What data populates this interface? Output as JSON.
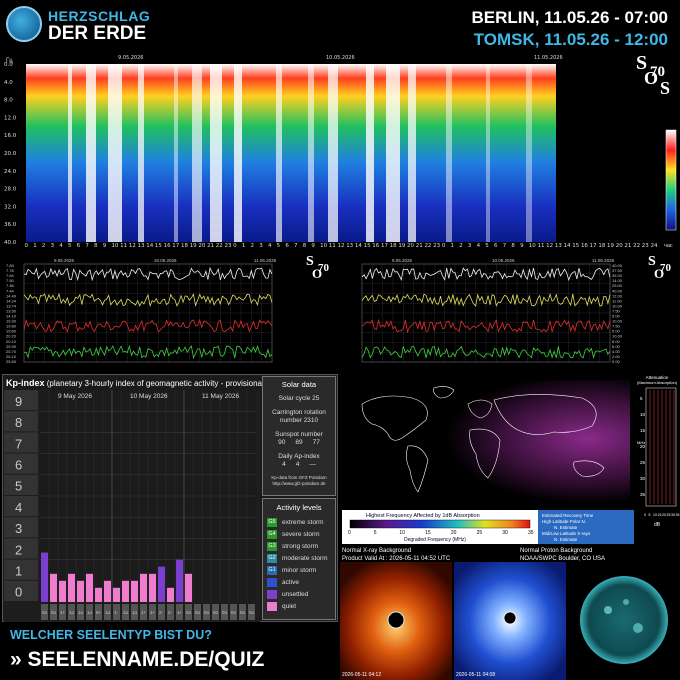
{
  "header": {
    "logo_line1": "HERZSCHLAG",
    "logo_line2": "DER ERDE",
    "city1": "BERLIN, 11.05.26 - 07:00",
    "city2": "TOMSK, 11.05.26 - 12:00"
  },
  "spectrogram": {
    "y_unit": "Гц",
    "y_ticks": [
      "0.0",
      "4.0",
      "8.0",
      "12.0",
      "16.0",
      "20.0",
      "24.0",
      "28.0",
      "32.0",
      "36.0",
      "40.0"
    ],
    "dates": [
      "9.05.2026",
      "10.05.2026",
      "11.05.2026"
    ],
    "x_ticks": [
      "0",
      "1",
      "2",
      "3",
      "4",
      "5",
      "6",
      "7",
      "8",
      "9",
      "10",
      "11",
      "12",
      "13",
      "14",
      "15",
      "16",
      "17",
      "18",
      "19",
      "20",
      "21",
      "22",
      "23",
      "0",
      "1",
      "2",
      "3",
      "4",
      "5",
      "6",
      "7",
      "8",
      "9",
      "10",
      "11",
      "12",
      "13",
      "14",
      "15",
      "16",
      "17",
      "18",
      "19",
      "20",
      "21",
      "22",
      "23",
      "0",
      "1",
      "2",
      "3",
      "4",
      "5",
      "6",
      "7",
      "8",
      "9",
      "10",
      "11",
      "12",
      "13",
      "14",
      "15",
      "16",
      "17",
      "18",
      "19",
      "20",
      "21",
      "22",
      "23",
      "24"
    ],
    "x_unit": "час",
    "sos_number": "70"
  },
  "line_panels": {
    "left": {
      "dates": [
        "9.05.2026",
        "10.05.2026",
        "11.05.2026"
      ],
      "y_ticks": [
        "7.83",
        "7.78",
        "7.64",
        "7.50",
        "7.46",
        "7.44",
        "14.40",
        "14.24",
        "13.74",
        "13.50",
        "14.10",
        "19.90",
        "19.80",
        "19.60",
        "20.20",
        "20.10",
        "25.90",
        "25.70",
        "26.10",
        "25.50"
      ]
    },
    "right": {
      "dates": [
        "9.05.2026",
        "10.05.2026",
        "11.05.2026"
      ],
      "y_ticks": [
        "40.00",
        "37.50",
        "35.00",
        "14.00",
        "25.00",
        "40.00",
        "12.00",
        "11.00",
        "10.00",
        "7.50",
        "5.00",
        "10.00",
        "7.50",
        "5.00",
        "10.00",
        "8.00",
        "6.00",
        "4.00",
        "2.00",
        "0.00"
      ]
    },
    "sos_number": "70"
  },
  "kp": {
    "title_bold": "Kp-index",
    "title_rest": "(planetary 3-hourly index of geomagnetic activity - provisional data)",
    "levels": [
      "9",
      "8",
      "7",
      "6",
      "5",
      "4",
      "3",
      "2",
      "1",
      "0"
    ],
    "days": [
      "9 May 2026",
      "10 May 2026",
      "11 May 2026"
    ],
    "tick_labels": [
      "0o",
      "0o",
      "1+",
      "1o",
      "1o",
      "1o",
      "0+",
      "1o",
      "1-",
      "1o",
      "1o",
      "1+",
      "1+",
      "2-",
      "2-",
      "1+",
      "0o",
      "0o",
      "0o",
      "0o",
      "0o",
      "0o",
      "0o",
      "0o"
    ]
  },
  "chart_data": {
    "type": "bar",
    "title": "Kp-index",
    "ylim": [
      0,
      9
    ],
    "categories": [
      "9 May 00",
      "9 May 03",
      "9 May 06",
      "9 May 09",
      "9 May 12",
      "9 May 15",
      "9 May 18",
      "9 May 21",
      "10 May 00",
      "10 May 03",
      "10 May 06",
      "10 May 09",
      "10 May 12",
      "10 May 15",
      "10 May 18",
      "10 May 21",
      "11 May 00",
      "11 May 03",
      "11 May 06",
      "11 May 09",
      "11 May 12",
      "11 May 15",
      "11 May 18",
      "11 May 21"
    ],
    "values": [
      2.33,
      1.33,
      1.0,
      1.33,
      1.0,
      1.33,
      0.67,
      1.0,
      0.67,
      1.0,
      1.0,
      1.33,
      1.33,
      1.67,
      0.67,
      2.0,
      1.33,
      0,
      0,
      0,
      0,
      0,
      0,
      0
    ],
    "colors": [
      "#7b3fd0",
      "#f07cd0",
      "#f07cd0",
      "#f07cd0",
      "#f07cd0",
      "#f07cd0",
      "#f07cd0",
      "#f07cd0",
      "#f07cd0",
      "#f07cd0",
      "#f07cd0",
      "#f07cd0",
      "#f07cd0",
      "#7b3fd0",
      "#f07cd0",
      "#7b3fd0",
      "#f07cd0",
      "#f07cd0",
      "#f07cd0",
      "#f07cd0",
      "#f07cd0",
      "#f07cd0",
      "#f07cd0",
      "#f07cd0"
    ]
  },
  "solar_data": {
    "title": "Solar data",
    "cycle": "Solar cycle 25",
    "carrington_l1": "Carrington rotation",
    "carrington_l2": "number 2310",
    "sunspot_label": "Sunspot number",
    "sunspot_values": [
      "90",
      "89",
      "77"
    ],
    "ap_label": "Daily Ap-index",
    "ap_values": [
      "4",
      "4",
      "—"
    ],
    "source_l1": "Kp-data from GFZ Potsdam",
    "source_l2": "http://www.gfz-potsdam.de"
  },
  "activity_levels": {
    "title": "Activity levels",
    "items": [
      {
        "code": "G5",
        "label": "extreme storm",
        "color": "#2a9a2a"
      },
      {
        "code": "G4",
        "label": "severe storm",
        "color": "#2a9a2a"
      },
      {
        "code": "G3",
        "label": "strong storm",
        "color": "#2a9a2a"
      },
      {
        "code": "G2",
        "label": "moderate storm",
        "color": "#2a8aa0"
      },
      {
        "code": "G1",
        "label": "minor storm",
        "color": "#2a6ab0"
      },
      {
        "code": "",
        "label": "active",
        "color": "#3050d0"
      },
      {
        "code": "",
        "label": "unsettled",
        "color": "#7b3fd0"
      },
      {
        "code": "",
        "label": "quiet",
        "color": "#f07cd0"
      }
    ]
  },
  "drap": {
    "colorbar_title": "Highest Frequency Affected by 1dB Absorption",
    "colorbar_ticks": [
      "0",
      "5",
      "10",
      "15",
      "20",
      "25",
      "30",
      "35"
    ],
    "colorbar_unit": "Degraded Frequency (MHz)",
    "note_l1": "Estimated Recovery Time",
    "note_l2": "High Latitude Polar N.",
    "note_l3": "N. Estimate",
    "note_l4": "Mid/Low Latitude X-rays",
    "note_l5": "N. Estimate",
    "xray": "Normal X-ray Background",
    "proton": "Normal Proton Background",
    "valid": "Product Valid At : 2026-05-11 04:52 UTC",
    "noaa": "NOAA/SWPC Boulder, CO USA",
    "atten_title_l1": "Attenuation",
    "atten_title_l2": "(Maximum Absorption)",
    "atten_y_ticks": [
      "5",
      "10",
      "15",
      "20",
      "25",
      "30",
      "35"
    ],
    "atten_y_unit": "MHz",
    "atten_x_ticks": [
      "0",
      "5",
      "10",
      "15",
      "20",
      "25",
      "30",
      "35"
    ],
    "atten_x_unit": "dB"
  },
  "solar_images": {
    "img1_caption": "2026-05-11 04:12",
    "img2_caption": "2026-05-11 04:08"
  },
  "footer": {
    "line1": "WELCHER SEELENTYP BIST DU?",
    "line2": "» SEELENNAME.DE/QUIZ"
  }
}
